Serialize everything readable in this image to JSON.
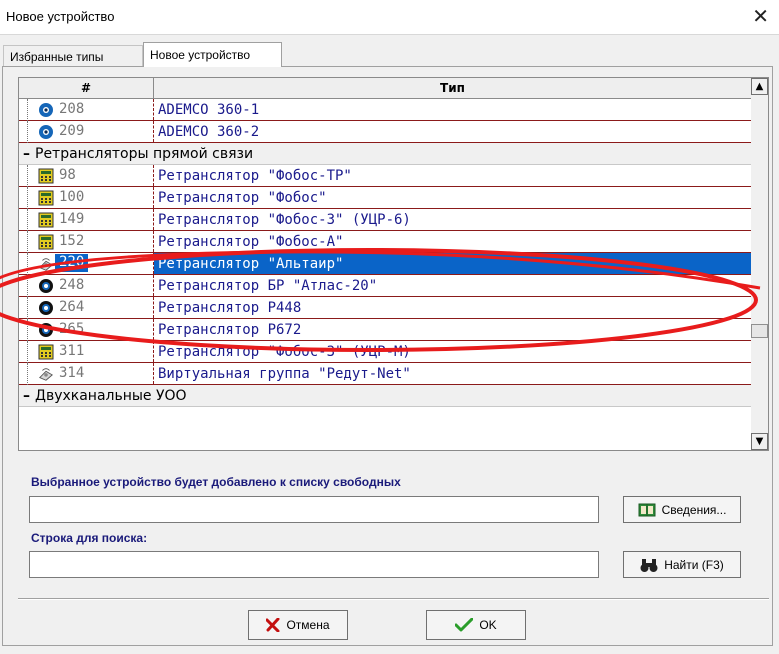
{
  "window": {
    "title": "Новое устройство",
    "close_glyph": "✕"
  },
  "tabs": [
    {
      "label": "Избранные типы",
      "active": false
    },
    {
      "label": "Новое устройство",
      "active": true
    }
  ],
  "grid": {
    "columns": [
      "#",
      "Тип"
    ],
    "rows": [
      {
        "kind": "device",
        "num": "208",
        "type": "ADEMCO 360-1",
        "icon": "blue-globe-icon"
      },
      {
        "kind": "device",
        "num": "209",
        "type": "ADEMCO 360-2",
        "icon": "blue-globe-icon"
      },
      {
        "kind": "group",
        "toggle": "–",
        "label": "Ретрансляторы прямой связи"
      },
      {
        "kind": "device",
        "num": "98",
        "type": "Ретранслятор \"Фобос-ТР\"",
        "icon": "panel-icon"
      },
      {
        "kind": "device",
        "num": "100",
        "type": "Ретранслятор \"Фобос\"",
        "icon": "panel-icon"
      },
      {
        "kind": "device",
        "num": "149",
        "type": "Ретранслятор \"Фобос-3\" (УЦР-6)",
        "icon": "panel-icon"
      },
      {
        "kind": "device",
        "num": "152",
        "type": "Ретранслятор \"Фобос-А\"",
        "icon": "panel-icon"
      },
      {
        "kind": "device",
        "num": "220",
        "type": "Ретранслятор \"Альтаир\"",
        "icon": "satellite-icon",
        "selected": true
      },
      {
        "kind": "device",
        "num": "248",
        "type": "Ретранслятор БР \"Атлас-20\"",
        "icon": "eye-icon"
      },
      {
        "kind": "device",
        "num": "264",
        "type": "Ретранслятор P448",
        "icon": "eye-icon"
      },
      {
        "kind": "device",
        "num": "265",
        "type": "Ретранслятор P672",
        "icon": "eye-icon"
      },
      {
        "kind": "device",
        "num": "311",
        "type": "Ретранслятор \"Фобос-3\" (УЦР-М)",
        "icon": "panel-icon"
      },
      {
        "kind": "device",
        "num": "314",
        "type": "Виртуальная группа \"Редут-Net\"",
        "icon": "satellite-icon"
      },
      {
        "kind": "group",
        "toggle": "–",
        "label": "Двухканальные УОО"
      }
    ]
  },
  "form": {
    "selected_label": "Выбранное устройство будет добавлено к списку свободных",
    "selected_value": "",
    "details_button": "Сведения...",
    "search_label": "Строка для поиска:",
    "search_value": "",
    "find_button": "Найти (F3)"
  },
  "buttons": {
    "cancel": "Отмена",
    "ok": "OK"
  },
  "colors": {
    "selection": "#0a64c8",
    "row_text": "#1a1a8c",
    "grid_lines": "#8b1a1a",
    "annotation": "#e81c1c"
  }
}
